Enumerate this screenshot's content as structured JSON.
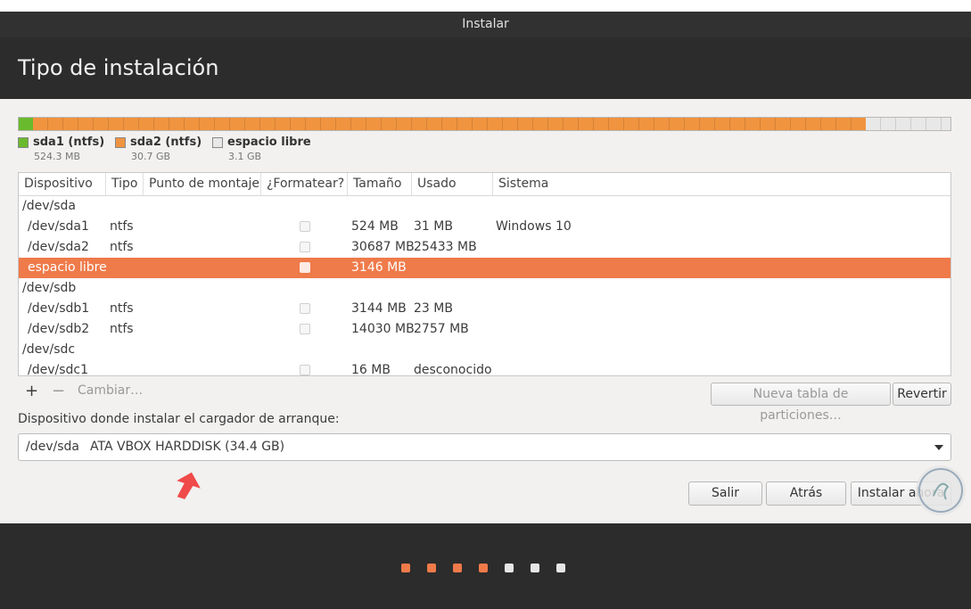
{
  "window": {
    "title": "Instalar"
  },
  "header": {
    "title": "Tipo de instalación"
  },
  "partition_bar": {
    "segments": [
      {
        "name": "sda1 (ntfs)",
        "size": "524.3 MB",
        "color": "#6aba2e",
        "fraction": 0.0152
      },
      {
        "name": "sda2 (ntfs)",
        "size": "30.7 GB",
        "color": "#f0943f",
        "fraction": 0.8939
      },
      {
        "name": "espacio libre",
        "size": "3.1 GB",
        "color": "#e8e8e8",
        "fraction": 0.0909
      }
    ]
  },
  "table": {
    "columns": [
      "Dispositivo",
      "Tipo",
      "Punto de montaje",
      "¿Formatear?",
      "Tamaño",
      "Usado",
      "Sistema"
    ],
    "rows": [
      {
        "device": "/dev/sda",
        "group": true
      },
      {
        "device": "/dev/sda1",
        "type": "ntfs",
        "mount": "",
        "format": false,
        "size": "524 MB",
        "used": "31 MB",
        "system": "Windows 10"
      },
      {
        "device": "/dev/sda2",
        "type": "ntfs",
        "mount": "",
        "format": false,
        "size": "30687 MB",
        "used": "25433 MB",
        "system": ""
      },
      {
        "device": "espacio libre",
        "type": "",
        "mount": "",
        "format": false,
        "size": "3146 MB",
        "used": "",
        "system": "",
        "selected": true
      },
      {
        "device": "/dev/sdb",
        "group": true
      },
      {
        "device": "/dev/sdb1",
        "type": "ntfs",
        "mount": "",
        "format": false,
        "size": "3144 MB",
        "used": "23 MB",
        "system": ""
      },
      {
        "device": "/dev/sdb2",
        "type": "ntfs",
        "mount": "",
        "format": false,
        "size": "14030 MB",
        "used": "2757 MB",
        "system": ""
      },
      {
        "device": "/dev/sdc",
        "group": true
      },
      {
        "device": "/dev/sdc1",
        "type": "",
        "mount": "",
        "format": false,
        "size": "16 MB",
        "used": "desconocido",
        "system": ""
      }
    ]
  },
  "toolbar": {
    "add": "+",
    "remove": "−",
    "change": "Cambiar…",
    "new_table": "Nueva tabla de particiones…",
    "revert": "Revertir"
  },
  "bootloader": {
    "label": "Dispositivo donde instalar el cargador de arranque:",
    "device": "/dev/sda",
    "disk": "ATA VBOX HARDDISK (34.4 GB)"
  },
  "buttons": {
    "quit": "Salir",
    "back": "Atrás",
    "install": "Instalar ahora"
  },
  "progress": {
    "steps_total": 7,
    "steps_done": 4,
    "active_color": "#ef7a4a",
    "inactive_color": "#e6e6e6"
  },
  "colors": {
    "selection": "#ef7a4a",
    "annotation_arrow": "#f04a4a"
  }
}
